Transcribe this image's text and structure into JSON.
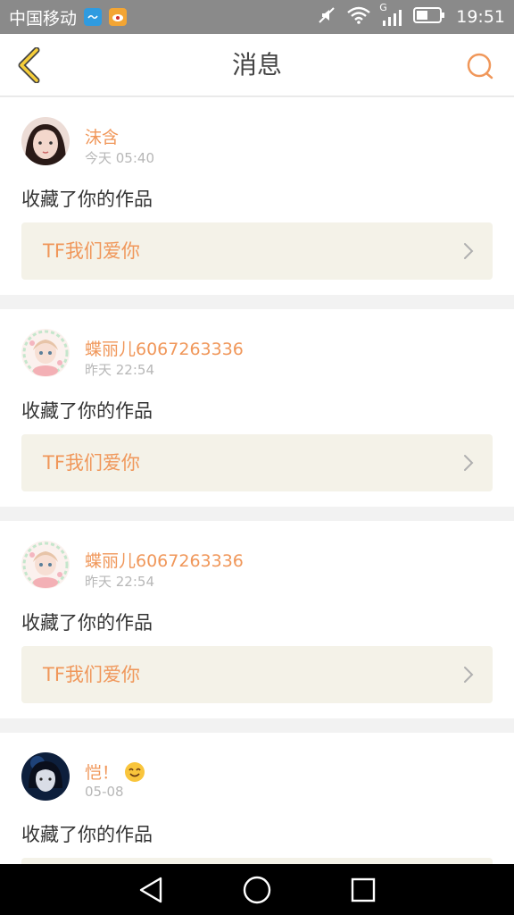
{
  "status_bar": {
    "carrier": "中国移动",
    "time": "19:51",
    "signal_type": "G",
    "icons": [
      "app-icon",
      "weibo-icon",
      "mute-icon",
      "wifi-icon",
      "signal-icon",
      "battery-icon"
    ],
    "bg_color": "#8a8a8a"
  },
  "header": {
    "title": "消息",
    "back_icon": "chevron-left-icon",
    "search_icon": "search-icon",
    "accent_color": "#f0975a"
  },
  "messages": [
    {
      "username": "沫含",
      "time": "今天 05:40",
      "action": "收藏了你的作品",
      "work_title": "TF我们爱你",
      "has_emoji": false
    },
    {
      "username": "蝶丽儿6067263336",
      "time": "昨天 22:54",
      "action": "收藏了你的作品",
      "work_title": "TF我们爱你",
      "has_emoji": false
    },
    {
      "username": "蝶丽儿6067263336",
      "time": "昨天 22:54",
      "action": "收藏了你的作品",
      "work_title": "TF我们爱你",
      "has_emoji": false
    },
    {
      "username": "恺！",
      "time": "05-08",
      "action": "收藏了你的作品",
      "work_title": "",
      "has_emoji": true
    }
  ],
  "nav_bar": {
    "buttons": [
      "back-triangle-icon",
      "home-circle-icon",
      "recents-square-icon"
    ]
  }
}
